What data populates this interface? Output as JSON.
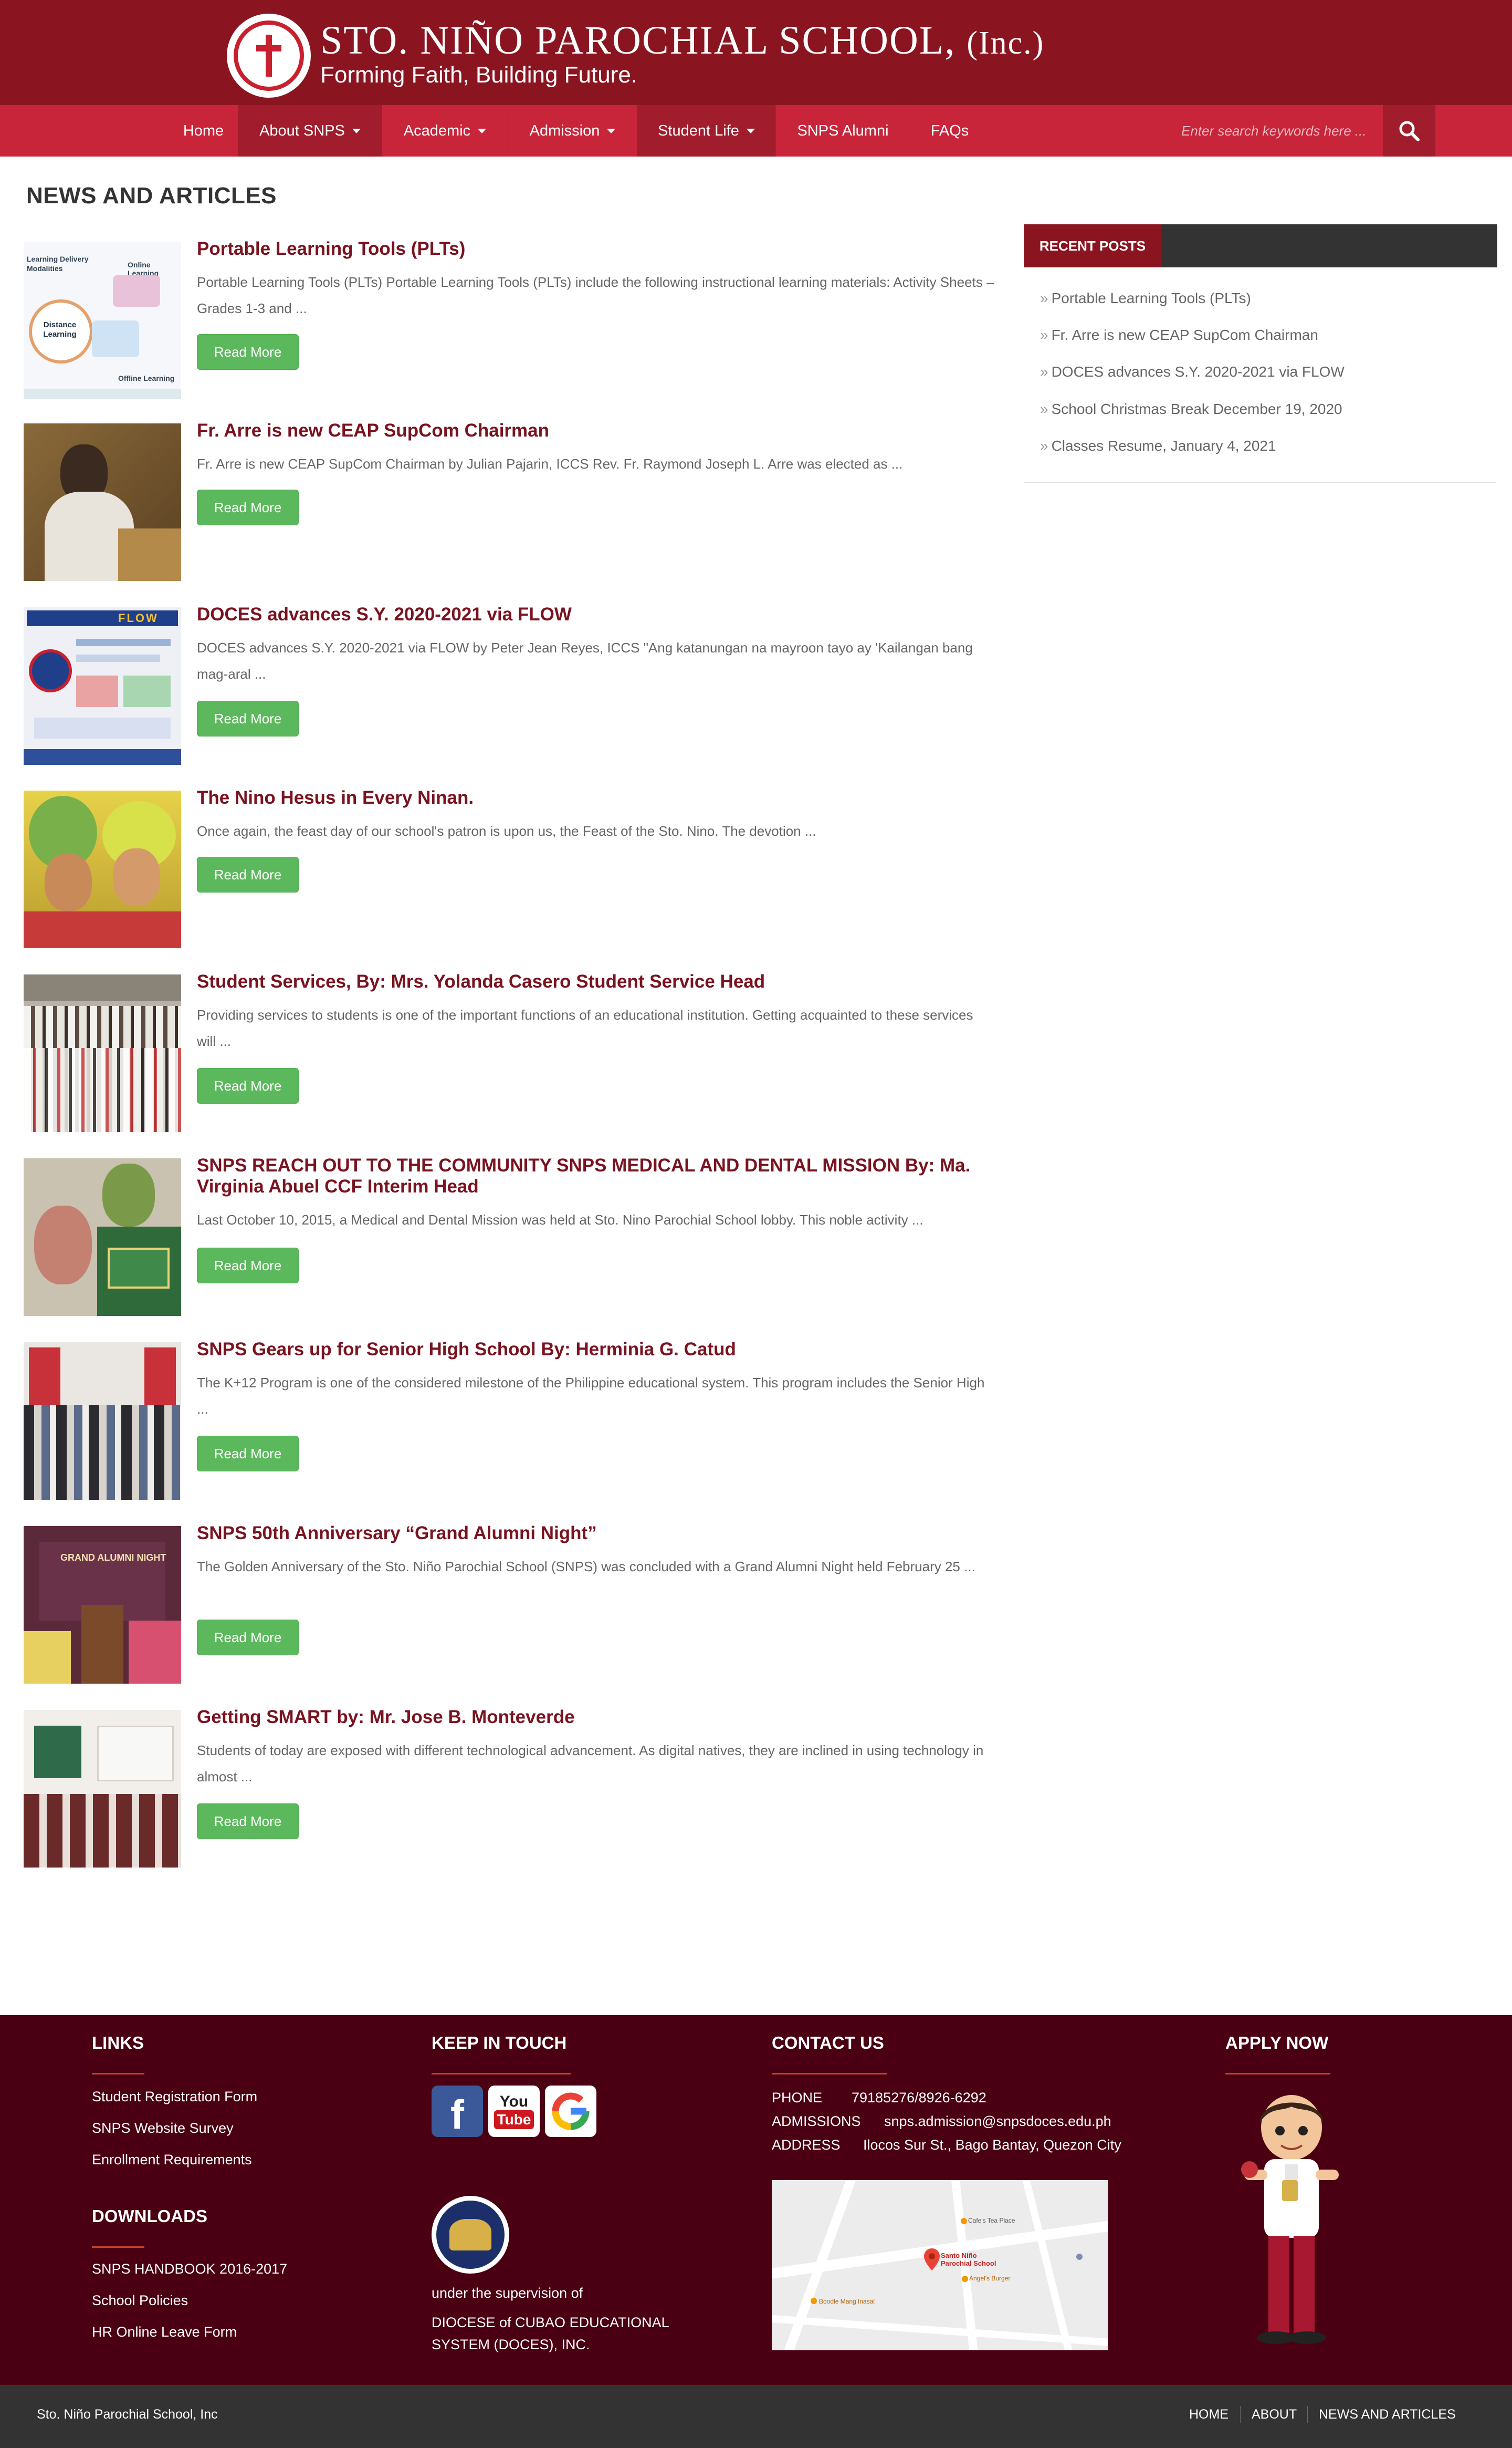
{
  "header": {
    "school_name": "STO. NIÑO PAROCHIAL SCHOOL,",
    "school_suffix": "(Inc.)",
    "tagline": "Forming Faith, Building Future."
  },
  "nav": {
    "items": [
      {
        "label": "Home",
        "dropdown": false
      },
      {
        "label": "About SNPS",
        "dropdown": true
      },
      {
        "label": "Academic",
        "dropdown": true
      },
      {
        "label": "Admission",
        "dropdown": true
      },
      {
        "label": "Student Life",
        "dropdown": true
      },
      {
        "label": "SNPS Alumni",
        "dropdown": false
      },
      {
        "label": "FAQs",
        "dropdown": false
      }
    ],
    "search_placeholder": "Enter search keywords here ..."
  },
  "main": {
    "page_title": "NEWS AND ARTICLES",
    "read_more_label": "Read More",
    "articles": [
      {
        "title": "Portable Learning Tools (PLTs)",
        "excerpt": " Portable Learning Tools (PLTs) Portable Learning Tools (PLTs) include the following instructional learning materials: Activity Sheets – Grades 1-3 and ..."
      },
      {
        "title": "Fr. Arre is new CEAP SupCom Chairman",
        "excerpt": "Fr. Arre is new CEAP SupCom Chairman by Julian Pajarin, ICCS Rev. Fr. Raymond Joseph L. Arre was elected as ..."
      },
      {
        "title": "DOCES advances S.Y. 2020-2021 via FLOW",
        "excerpt": "DOCES advances S.Y. 2020-2021 via FLOW by Peter Jean Reyes, ICCS \"Ang katanungan na mayroon tayo ay 'Kailangan bang mag-aral ..."
      },
      {
        "title": "The Nino Hesus in Every Ninan.",
        "excerpt": "Once again, the feast day of our school's patron is upon us, the Feast of the Sto. Nino. The devotion ..."
      },
      {
        "title": "Student Services, By: Mrs. Yolanda Casero Student Service Head",
        "excerpt": "Providing services to students is one of the important functions of an educational institution. Getting acquainted to these services will ..."
      },
      {
        "title": "SNPS REACH OUT TO THE COMMUNITY SNPS MEDICAL AND DENTAL MISSION By: Ma. Virginia Abuel CCF Interim Head",
        "excerpt": "Last October 10, 2015, a Medical and Dental Mission was held at Sto. Nino Parochial School lobby. This noble activity ..."
      },
      {
        "title": "SNPS Gears up for Senior High School By: Herminia G. Catud",
        "excerpt": "The K+12 Program is one of the considered milestone of the Philippine educational system. This program includes the Senior High ..."
      },
      {
        "title": "SNPS 50th Anniversary “Grand Alumni Night”",
        "excerpt": "The Golden Anniversary of the Sto. Niño Parochial School (SNPS) was concluded with a Grand Alumni Night held February 25 ..."
      },
      {
        "title": "Getting SMART by: Mr. Jose B. Monteverde",
        "excerpt": "Students of today are exposed with different technological advancement. As digital natives, they are inclined in using technology in almost ..."
      }
    ]
  },
  "thumbnails": {
    "plt": {
      "line1": "Learning Delivery",
      "line2": "Modalities",
      "online": "Online Learning",
      "distance": "Distance Learning",
      "offline": "Offline Learning"
    },
    "flow": "FLOW",
    "alumni": "GRAND ALUMNI NIGHT"
  },
  "sidebar": {
    "title": "RECENT POSTS",
    "items": [
      "Portable Learning Tools (PLTs)",
      "Fr. Arre is new CEAP SupCom Chairman",
      "DOCES advances S.Y. 2020-2021 via FLOW",
      "School Christmas Break December 19, 2020",
      "Classes Resume, January 4, 2021"
    ]
  },
  "footer": {
    "links": {
      "title": "LINKS",
      "items": [
        "Student Registration Form",
        "SNPS Website Survey",
        "Enrollment Requirements"
      ]
    },
    "downloads": {
      "title": "DOWNLOADS",
      "items": [
        "SNPS HANDBOOK 2016-2017",
        "School Policies",
        "HR Online Leave Form"
      ]
    },
    "keep_in_touch": {
      "title": "KEEP IN TOUCH",
      "youtube_top": "You",
      "youtube_bottom": "Tube",
      "supervision": "under the supervision of",
      "diocese": "DIOCESE of CUBAO EDUCATIONAL SYSTEM (DOCES), INC."
    },
    "contact": {
      "title": "CONTACT US",
      "phone_label": "PHONE",
      "phone": "79185276/8926-6292",
      "admissions_label": "ADMISSIONS",
      "admissions": "snps.admission@snpsdoces.edu.ph",
      "address_label": "ADDRESS",
      "address": "Ilocos Sur St., Bago Bantay, Quezon City",
      "map_labels": [
        "Santo Niño Parochial School",
        "Cafe's Tea Place",
        "Angel's Burger",
        "Boodle Mang Inasal"
      ]
    },
    "apply": {
      "title": "APPLY NOW"
    }
  },
  "bottombar": {
    "copyright": "Sto. Niño Parochial School, Inc",
    "links": [
      "HOME",
      "ABOUT",
      "NEWS AND ARTICLES"
    ]
  },
  "colors": {
    "header_bg": "#8a1520",
    "nav_bg": "#c8243a",
    "title_red": "#7a1320",
    "button_green": "#5cb85c",
    "footer_bg": "#4a0012",
    "bottombar_bg": "#333333"
  }
}
